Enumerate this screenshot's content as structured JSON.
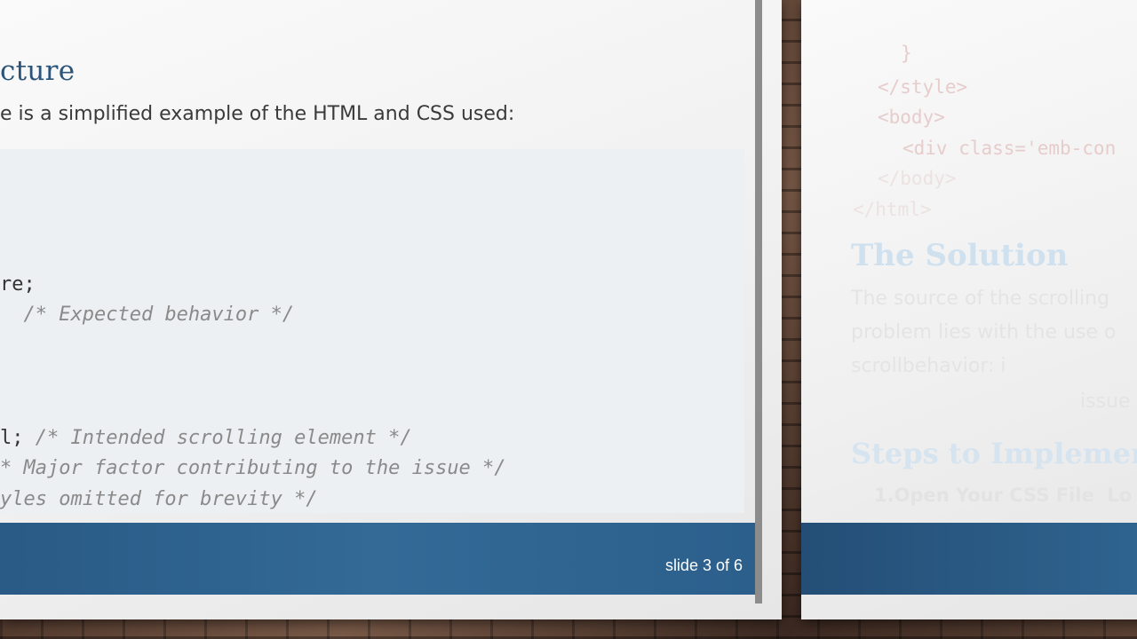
{
  "current_slide": {
    "title": "cture",
    "intro": "e is a simplified example of the HTML and CSS used:",
    "code_lines": [
      {
        "code": "re;",
        "comment": ""
      },
      {
        "code": "  ",
        "comment": "/* Expected behavior */"
      },
      {
        "code": "l; ",
        "comment": "/* Intended scrolling element */"
      },
      {
        "code": "",
        "comment": "* Major factor contributing to the issue */"
      },
      {
        "code": "",
        "comment": "yles omitted for brevity */"
      }
    ],
    "slide_counter": "slide 3 of 6"
  },
  "next_slide": {
    "code_lines": [
      "}",
      "</style>",
      "<body>",
      "<div class='emb-con",
      "</body>",
      "</html>"
    ],
    "title": "The Solution",
    "text_lines": [
      "The source of the scrolling",
      "problem lies with the use o",
      "scrollbehavior: i",
      "issue"
    ],
    "heading": "Steps to Implemen",
    "step": "1.Open Your CSS File  Lo"
  },
  "colors": {
    "title": "#2b5478",
    "footer_bar": "#336a96",
    "code_background": "#edf0f2",
    "comment": "#8a8a8a"
  }
}
